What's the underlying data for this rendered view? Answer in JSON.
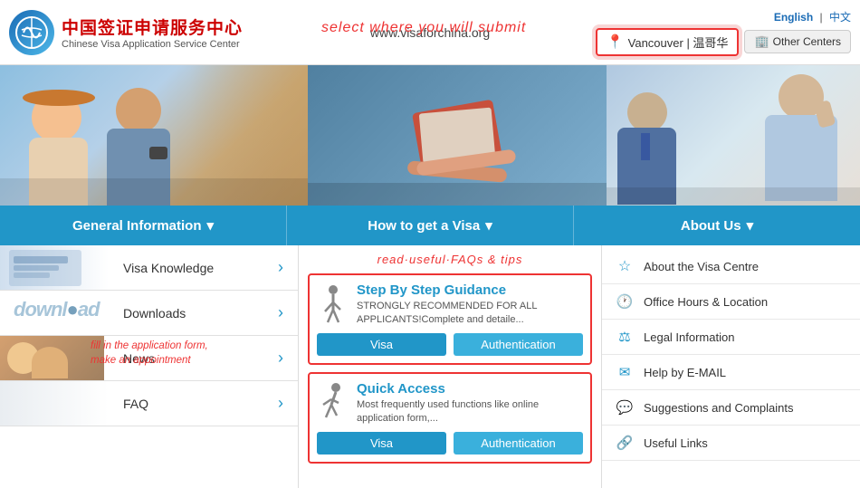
{
  "header": {
    "url": "www.visaforchina.org",
    "logo_alt": "China Visa Logo",
    "site_name_cn": "中国签证申请服务中心",
    "site_name_en": "Chinese Visa Application Service Center",
    "lang_english": "English",
    "lang_separator": "|",
    "lang_chinese": "中文",
    "submit_hint": "select where you will submit",
    "location": "Vancouver | 温哥华",
    "other_centers": "Other Centers"
  },
  "nav": {
    "items": [
      {
        "label": "General Information",
        "arrow": "▾"
      },
      {
        "label": "How to get a Visa",
        "arrow": "▾"
      },
      {
        "label": "About Us",
        "arrow": "▾"
      }
    ]
  },
  "left_menu": {
    "visa_knowledge": "Visa Knowledge",
    "downloads": "Downloads",
    "news": "News",
    "fill_hint_line1": "fill in the application form,",
    "fill_hint_line2": "make an appointment",
    "faq": "FAQ"
  },
  "mid_panel": {
    "hint": "read·useful·FAQs & tips",
    "card1": {
      "title": "Step By Step Guidance",
      "desc": "STRONGLY RECOMMENDED FOR ALL APPLICANTS!Complete and detaile...",
      "btn_visa": "Visa",
      "btn_auth": "Authentication"
    },
    "card2": {
      "title": "Quick Access",
      "desc": "Most frequently used functions like online application form,...",
      "btn_visa": "Visa",
      "btn_auth": "Authentication"
    }
  },
  "right_panel": {
    "items": [
      {
        "icon": "★",
        "label": "About the Visa Centre"
      },
      {
        "icon": "🕐",
        "label": "Office Hours & Location"
      },
      {
        "icon": "⚖",
        "label": "Legal Information"
      },
      {
        "icon": "✉",
        "label": "Help by E-MAIL"
      },
      {
        "icon": "💬",
        "label": "Suggestions and Complaints"
      },
      {
        "icon": "🔗",
        "label": "Useful Links"
      }
    ]
  },
  "colors": {
    "primary": "#2196c8",
    "accent": "#e33",
    "nav_bg": "#2196c8"
  }
}
